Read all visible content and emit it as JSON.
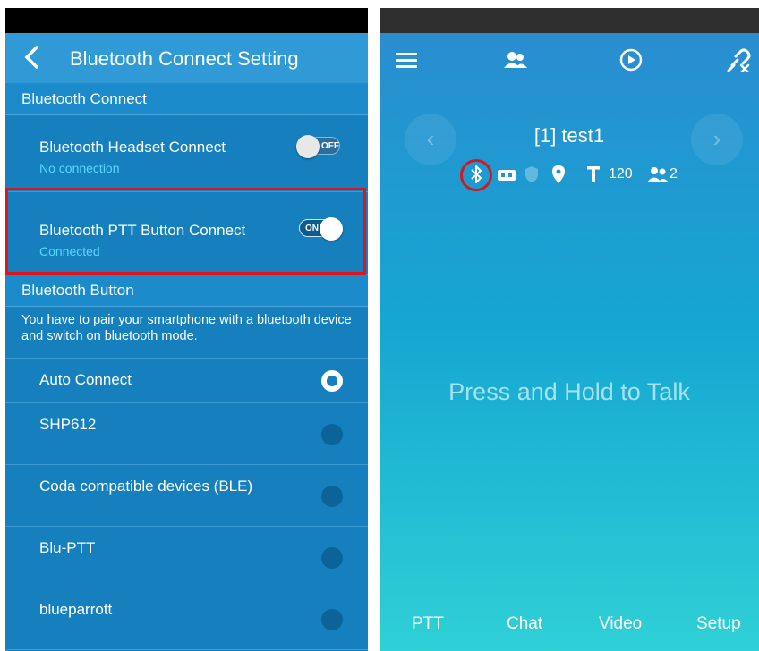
{
  "settings": {
    "title": "Bluetooth Connect Setting",
    "section_connect": "Bluetooth Connect",
    "headset": {
      "label": "Bluetooth Headset Connect",
      "status": "No connection",
      "toggle": "OFF"
    },
    "ptt": {
      "label": "Bluetooth PTT Button Connect",
      "status": "Connected",
      "toggle": "ON"
    },
    "section_button": "Bluetooth Button",
    "note": "You have to pair your smartphone with a bluetooth device and switch on bluetooth mode.",
    "options": [
      {
        "label": "Auto Connect",
        "selected": true
      },
      {
        "label": "SHP612",
        "selected": false
      },
      {
        "label": "Coda compatible devices (BLE)",
        "selected": false
      },
      {
        "label": "Blu-PTT",
        "selected": false
      },
      {
        "label": "blueparrott",
        "selected": false
      }
    ],
    "colors": {
      "highlight": "#e0141e",
      "accent": "#5ad6ff"
    }
  },
  "main": {
    "channel_title": "[1] test1",
    "timer": "120",
    "member_count": "2",
    "prompt": "Press and Hold to Talk",
    "nav": {
      "ptt": "PTT",
      "chat": "Chat",
      "video": "Video",
      "setup": "Setup"
    },
    "icons": [
      "menu-icon",
      "contacts-icon",
      "playback-icon",
      "unlink-icon",
      "bluetooth-icon",
      "card-icon",
      "shield-icon",
      "location-icon",
      "text-icon",
      "group-icon"
    ]
  }
}
